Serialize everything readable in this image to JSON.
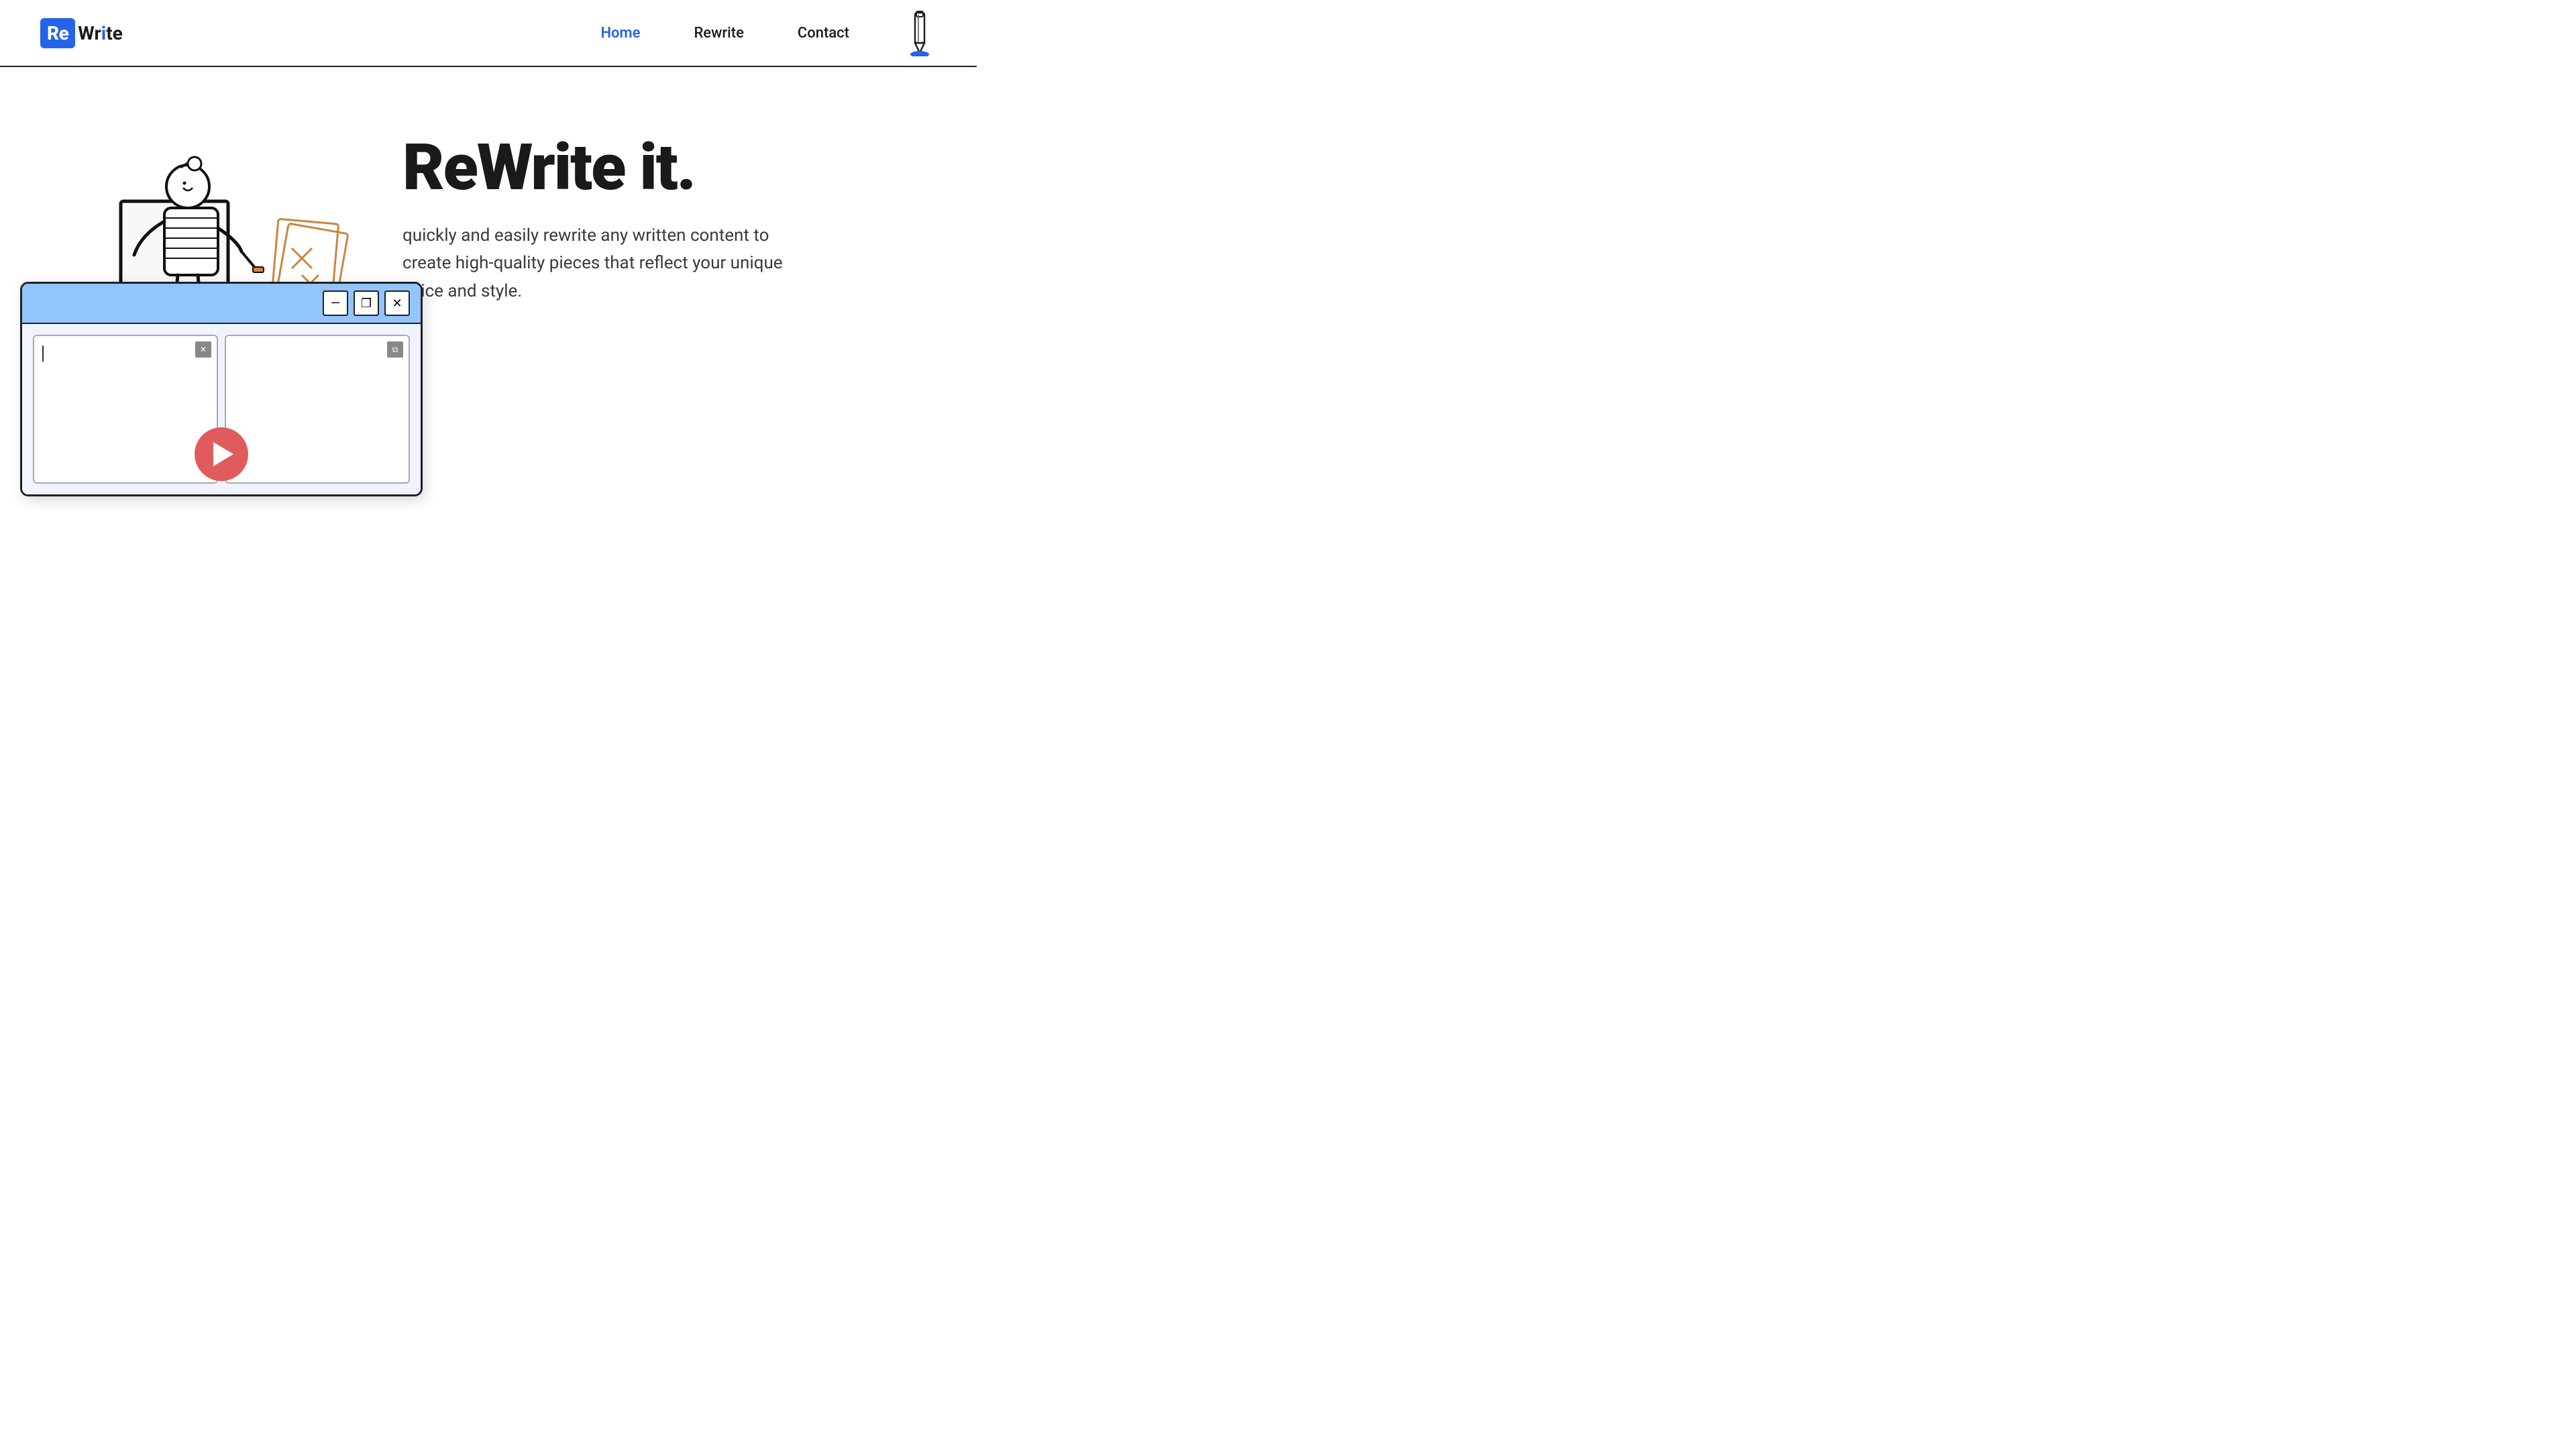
{
  "logo": {
    "re": "Re",
    "write_part1": "Wr",
    "write_highlight": "i",
    "write_part2": "te"
  },
  "nav": {
    "home": "Home",
    "rewrite": "Rewrite",
    "contact": "Contact"
  },
  "hero": {
    "title": "ReWrite it.",
    "subtitle": "quickly and easily rewrite any written content to create high-quality pieces that reflect your unique voice and style."
  },
  "window": {
    "btn_minimize": "—",
    "btn_maximize": "❐",
    "btn_close": "✕"
  },
  "colors": {
    "accent": "#2563EB",
    "play": "#E05C5C",
    "titlebar": "#93C5FD"
  }
}
